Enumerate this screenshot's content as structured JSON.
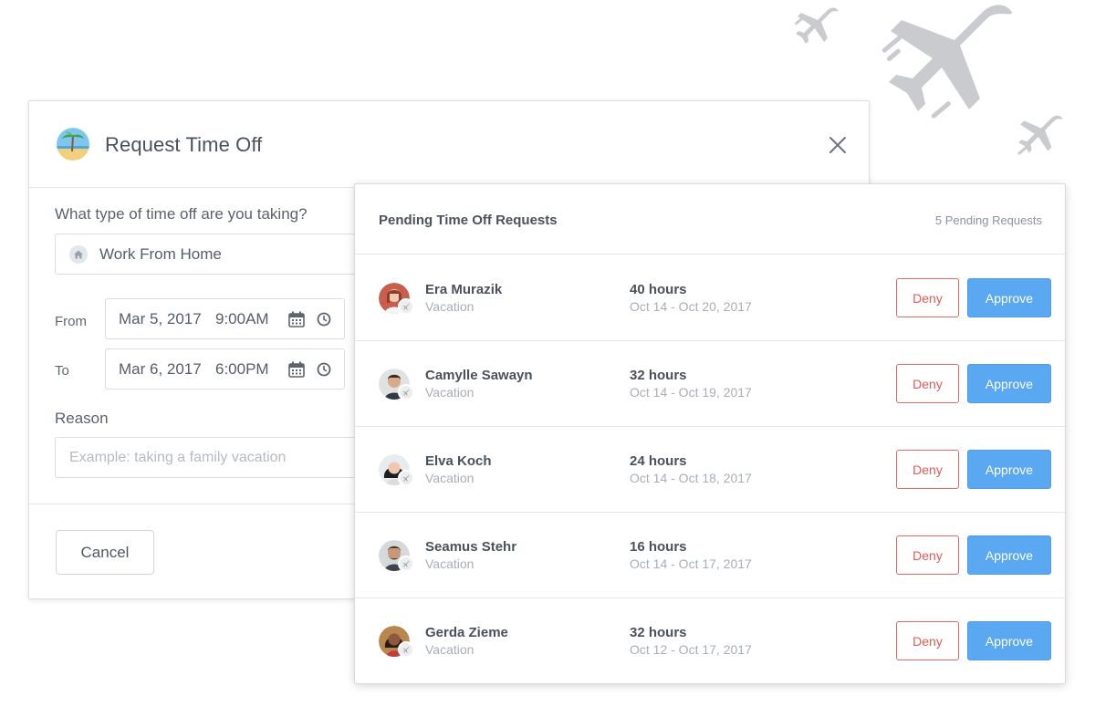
{
  "modal": {
    "title": "Request Time Off",
    "question_label": "What type of time off are you taking?",
    "type_value": "Work From Home",
    "from_label": "From",
    "from_date": "Mar 5, 2017",
    "from_time": "9:00AM",
    "to_label": "To",
    "to_date": "Mar 6, 2017",
    "to_time": "6:00PM",
    "reason_label": "Reason",
    "reason_placeholder": "Example: taking a family vacation",
    "cancel_label": "Cancel"
  },
  "pending": {
    "title": "Pending Time Off Requests",
    "count_label": "5 Pending Requests",
    "deny_label": "Deny",
    "approve_label": "Approve",
    "requests": [
      {
        "name": "Era Murazik",
        "type": "Vacation",
        "hours": "40 hours",
        "dates": "Oct 14 - Oct 20, 2017"
      },
      {
        "name": "Camylle Sawayn",
        "type": "Vacation",
        "hours": "32 hours",
        "dates": "Oct 14 - Oct 19, 2017"
      },
      {
        "name": "Elva Koch",
        "type": "Vacation",
        "hours": "24 hours",
        "dates": "Oct 14 - Oct 18, 2017"
      },
      {
        "name": "Seamus Stehr",
        "type": "Vacation",
        "hours": "16 hours",
        "dates": "Oct 14 - Oct 17, 2017"
      },
      {
        "name": "Gerda Zieme",
        "type": "Vacation",
        "hours": "32 hours",
        "dates": "Oct 12 - Oct 17, 2017"
      }
    ]
  },
  "icons": {
    "modal_icon": "beach-icon",
    "close": "close-icon",
    "type_icon": "home-icon",
    "calendar": "calendar-icon",
    "clock": "clock-icon",
    "avatar_badge": "airplane-icon",
    "decoration": "airplane-icon"
  },
  "colors": {
    "approve": "#5aa7f2",
    "deny": "#e05a54",
    "decoration": "#c9cbcf"
  }
}
